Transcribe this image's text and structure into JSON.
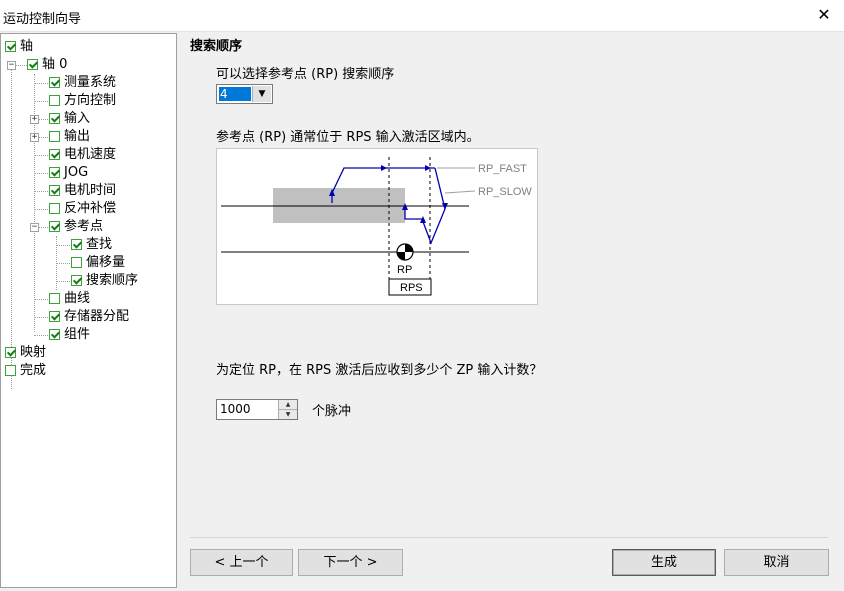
{
  "window": {
    "title": "运动控制向导",
    "close": "✕"
  },
  "tree": {
    "axis": "轴",
    "axis0": "轴 0",
    "measure": "测量系统",
    "direction": "方向控制",
    "input": "输入",
    "output": "输出",
    "motor_speed": "电机速度",
    "jog": "JOG",
    "motor_time": "电机时间",
    "backlash": "反冲补偿",
    "ref_point": "参考点",
    "find": "查找",
    "offset": "偏移量",
    "search_order": "搜索顺序",
    "curve": "曲线",
    "memory": "存储器分配",
    "component": "组件",
    "mapping": "映射",
    "done": "完成"
  },
  "page": {
    "heading": "搜索顺序",
    "select_label": "可以选择参考点 (RP) 搜索顺序",
    "order_value": "4",
    "diagram_caption": "参考点 (RP) 通常位于 RPS 输入激活区域内。",
    "question": "为定位 RP，在 RPS 激活后应收到多少个 ZP 输入计数？",
    "pulses_value": "1000",
    "pulses_unit": "个脉冲"
  },
  "diagram": {
    "rp_fast": "RP_FAST",
    "rp_slow": "RP_SLOW",
    "rp": "RP",
    "rps": "RPS"
  },
  "buttons": {
    "prev": "< 上一个",
    "next": "下一个 >",
    "generate": "生成",
    "cancel": "取消"
  },
  "colors": {
    "path": "#0000b0",
    "zone": "#c0c0c0",
    "check": "#1b7a1b"
  }
}
